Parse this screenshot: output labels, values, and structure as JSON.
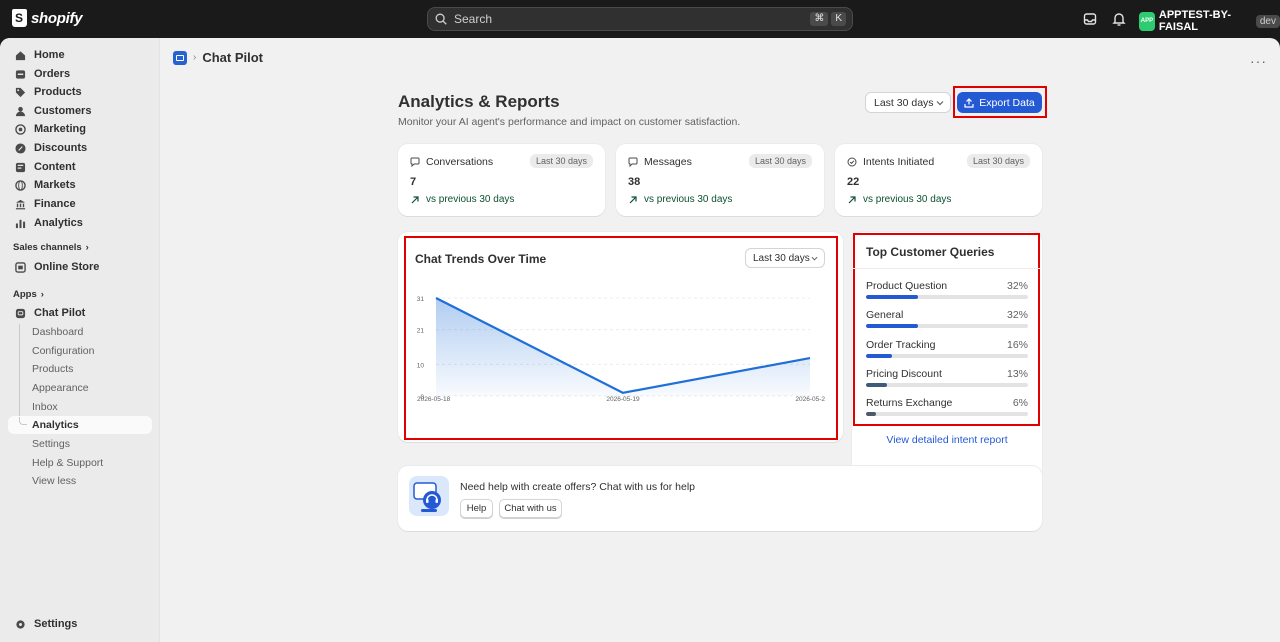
{
  "topbar": {
    "brand": "shopify",
    "search_placeholder": "Search",
    "shortcut_keys": [
      "⌘",
      "K"
    ],
    "store_name": "APPTEST-BY-FAISAL",
    "avatar_initials": "APP",
    "env_tag": "dev"
  },
  "sidebar": {
    "items": [
      {
        "label": "Home",
        "icon": "home-icon"
      },
      {
        "label": "Orders",
        "icon": "orders-icon"
      },
      {
        "label": "Products",
        "icon": "tag-icon"
      },
      {
        "label": "Customers",
        "icon": "person-icon"
      },
      {
        "label": "Marketing",
        "icon": "target-icon"
      },
      {
        "label": "Discounts",
        "icon": "discount-icon"
      },
      {
        "label": "Content",
        "icon": "content-icon"
      },
      {
        "label": "Markets",
        "icon": "globe-icon"
      },
      {
        "label": "Finance",
        "icon": "bank-icon"
      },
      {
        "label": "Analytics",
        "icon": "bar-chart-icon"
      }
    ],
    "sales_channels_label": "Sales channels",
    "online_store_label": "Online Store",
    "apps_label": "Apps",
    "app_name": "Chat Pilot",
    "app_subitems": [
      "Dashboard",
      "Configuration",
      "Products",
      "Appearance",
      "Inbox",
      "Analytics",
      "Settings",
      "Help & Support",
      "View less"
    ],
    "settings_label": "Settings"
  },
  "page": {
    "breadcrumb_title": "Chat Pilot",
    "title": "Analytics & Reports",
    "subtitle": "Monitor your AI agent's performance and impact on customer satisfaction.",
    "range_label": "Last 30 days",
    "export_label": "Export Data"
  },
  "stats": [
    {
      "label": "Conversations",
      "badge": "Last 30 days",
      "value": "7",
      "trend": "vs previous 30 days"
    },
    {
      "label": "Messages",
      "badge": "Last 30 days",
      "value": "38",
      "trend": "vs previous 30 days"
    },
    {
      "label": "Intents Initiated",
      "badge": "Last 30 days",
      "value": "22",
      "trend": "vs previous 30 days"
    }
  ],
  "chart_card": {
    "title": "Chat Trends Over Time",
    "range_label": "Last 30 days"
  },
  "chart_data": {
    "type": "area",
    "title": "Chat Trends Over Time",
    "x": [
      "2026-05-18",
      "2026-05-19",
      "2026-05-2"
    ],
    "series": [
      {
        "values": [
          31,
          1,
          12
        ]
      }
    ],
    "y_ticks": [
      "31",
      "21",
      "10",
      "0"
    ],
    "ylim": [
      0,
      31
    ],
    "grid": true,
    "color": "#1f6fd8"
  },
  "queries": {
    "title": "Top Customer Queries",
    "items": [
      {
        "label": "Product Question",
        "pct": "32%",
        "value": 32,
        "color": "#2459d4"
      },
      {
        "label": "General",
        "pct": "32%",
        "value": 32,
        "color": "#2459d4"
      },
      {
        "label": "Order Tracking",
        "pct": "16%",
        "value": 16,
        "color": "#2459d4"
      },
      {
        "label": "Pricing Discount",
        "pct": "13%",
        "value": 13,
        "color": "#3e5a7a"
      },
      {
        "label": "Returns Exchange",
        "pct": "6%",
        "value": 6,
        "color": "#4a5a6a"
      }
    ],
    "link": "View detailed intent report"
  },
  "help": {
    "text": "Need help with create offers? Chat with us for help",
    "help_button": "Help",
    "chat_button": "Chat with us"
  }
}
